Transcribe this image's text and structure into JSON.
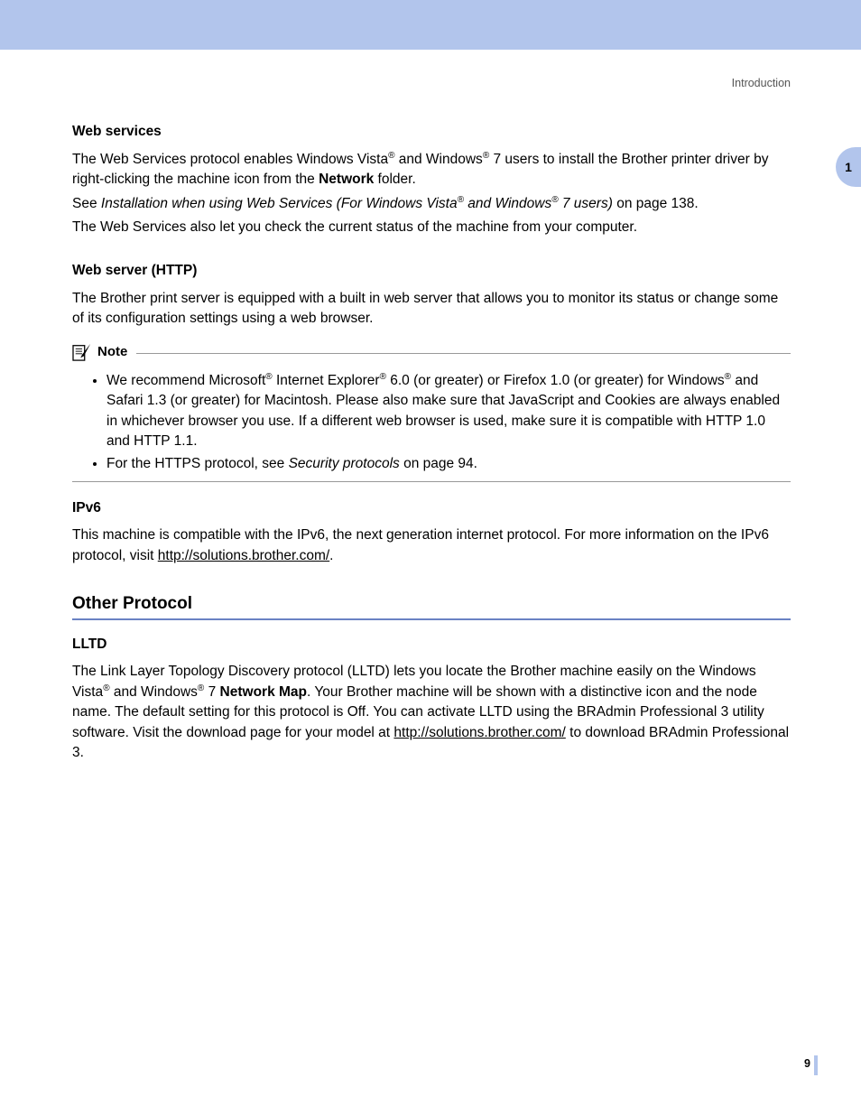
{
  "header": {
    "section": "Introduction"
  },
  "sideTab": "1",
  "sections": {
    "webServices": {
      "title": "Web services",
      "p1a": "The Web Services protocol enables Windows Vista",
      "p1b": " and Windows",
      "p1c": " 7 users to install the Brother printer driver by right-clicking the machine icon from the ",
      "p1d": "Network",
      "p1e": " folder.",
      "p2a": "See ",
      "p2b": "Installation when using Web Services (For Windows Vista",
      "p2c": " and Windows",
      "p2d": " 7 users)",
      "p2e": " on page 138.",
      "p3": "The Web Services also let you check the current status of the machine from your computer."
    },
    "webServer": {
      "title": "Web server (HTTP)",
      "p1": "The Brother print server is equipped with a built in web server that allows you to monitor its status or change some of its configuration settings using a web browser."
    },
    "note": {
      "label": "Note",
      "b1a": "We recommend Microsoft",
      "b1b": " Internet Explorer",
      "b1c": " 6.0 (or greater) or Firefox 1.0 (or greater) for Windows",
      "b1d": " and Safari 1.3 (or greater) for Macintosh. Please also make sure that JavaScript and Cookies are always enabled in whichever browser you use. If a different web browser is used, make sure it is compatible with HTTP 1.0 and HTTP 1.1.",
      "b2a": "For the HTTPS protocol, see ",
      "b2b": "Security protocols",
      "b2c": " on page 94."
    },
    "ipv6": {
      "title": "IPv6",
      "p1a": "This machine is compatible with the IPv6, the next generation internet protocol. For more information on the IPv6 protocol, visit ",
      "link": "http://solutions.brother.com/",
      "p1b": "."
    },
    "otherProtocol": {
      "title": "Other Protocol"
    },
    "lltd": {
      "title": "LLTD",
      "p1a": "The Link Layer Topology Discovery protocol (LLTD) lets you locate the Brother machine easily on the Windows Vista",
      "p1b": " and Windows",
      "p1c": " 7 ",
      "p1d": "Network Map",
      "p1e": ". Your Brother machine will be shown with a distinctive icon and the node name. The default setting for this protocol is Off. You can activate LLTD using the BRAdmin Professional 3 utility software. Visit the download page for your model at ",
      "link": "http://solutions.brother.com/",
      "p1f": " to download BRAdmin Professional 3."
    }
  },
  "reg": "®",
  "pageNumber": "9"
}
